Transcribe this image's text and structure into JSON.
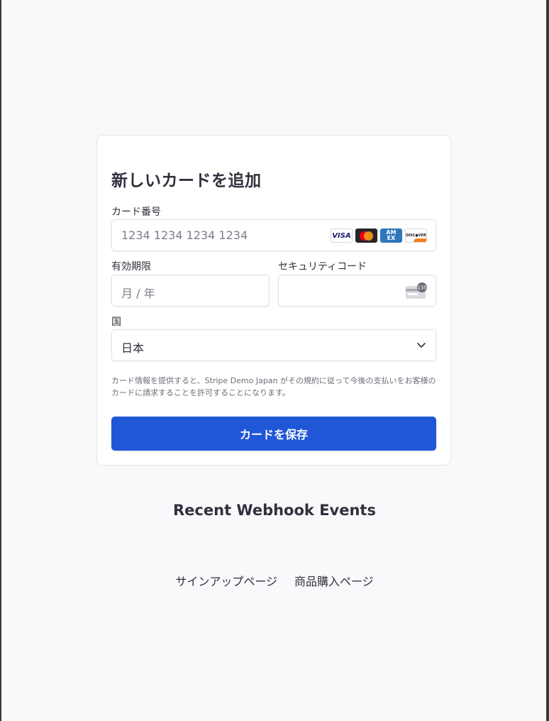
{
  "form": {
    "title": "新しいカードを追加",
    "card_number_label": "カード番号",
    "card_number_placeholder": "1234 1234 1234 1234",
    "expiry_label": "有効期限",
    "expiry_placeholder": "月 / 年",
    "cvc_label": "セキュリティコード",
    "cvc_icon_text": "135",
    "country_label": "国",
    "country_value": "日本",
    "card_brands": [
      "VISA",
      "mastercard",
      "AMEX",
      "DISCOVER"
    ],
    "legal_text": "カード情報を提供すると、Stripe Demo Japan がその規約に従って今後の支払いをお客様のカードに請求することを許可することになります。",
    "save_label": "カードを保存"
  },
  "webhook": {
    "title": "Recent Webhook Events"
  },
  "links": {
    "signup": "サインアップページ",
    "purchase": "商品購入ページ"
  },
  "colors": {
    "primary": "#1f57d6",
    "background": "#f8f9fa",
    "text": "#30313d"
  }
}
